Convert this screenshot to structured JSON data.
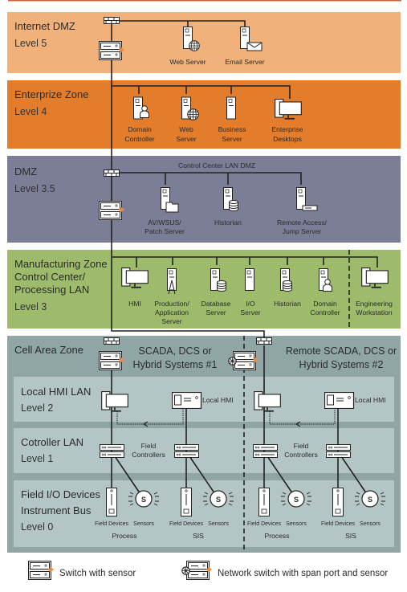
{
  "colors": {
    "internet_dmz": "#f0b27a",
    "enterprise": "#e37d2b",
    "dmz": "#7b7e96",
    "manufacturing": "#9dbb6b",
    "cell_area": "#8fa6a5",
    "cell_subzone": "#b3c5c4",
    "sensor_accent": "#f08a3c"
  },
  "zones": {
    "internet_dmz": {
      "title": "Internet DMZ",
      "level": "Level 5",
      "devices": [
        {
          "label": [
            "Web Server"
          ],
          "icon": "server-globe-icon"
        },
        {
          "label": [
            "Email Server"
          ],
          "icon": "server-email-icon"
        }
      ]
    },
    "enterprise": {
      "title": "Enterprize Zone",
      "level": "Level 4",
      "devices": [
        {
          "label": [
            "Domain",
            "Controller"
          ],
          "icon": "server-user-icon"
        },
        {
          "label": [
            "Web",
            "Server"
          ],
          "icon": "server-globe-icon"
        },
        {
          "label": [
            "Business",
            "Server"
          ],
          "icon": "server-icon"
        },
        {
          "label": [
            "Enterprise",
            "Desktops"
          ],
          "icon": "desktop-icon"
        }
      ]
    },
    "dmz": {
      "title": "DMZ",
      "level": "Level 3.5",
      "network": "Control Center LAN DMZ",
      "devices": [
        {
          "label": [
            "AV/WSUS/",
            "Patch Server"
          ],
          "icon": "server-folder-icon"
        },
        {
          "label": [
            "Historian"
          ],
          "icon": "server-database-icon"
        },
        {
          "label": [
            "Remote Access/",
            "Jump Server"
          ],
          "icon": "server-remote-icon"
        }
      ]
    },
    "manufacturing": {
      "title": [
        "Manufacturing Zone",
        "Control Center/",
        "Processing LAN"
      ],
      "level": "Level 3",
      "devices": [
        {
          "label": [
            "HMI"
          ]
        },
        {
          "label": [
            "Production/",
            "Application",
            "Server"
          ]
        },
        {
          "label": [
            "Database",
            "Server"
          ]
        },
        {
          "label": [
            "I/O",
            "Server"
          ]
        },
        {
          "label": [
            "Historian"
          ]
        },
        {
          "label": [
            "Domain",
            "Controller"
          ]
        },
        {
          "label": [
            "Engineering",
            "Workstation"
          ]
        }
      ]
    },
    "cell_area": {
      "title": "Cell Area Zone",
      "system1": [
        "SCADA, DCS or",
        "Hybrid Systems #1"
      ],
      "system2": [
        "Remote SCADA, DCS or",
        "Hybrid Systems #2"
      ],
      "local_hmi_lan": {
        "title": "Local HMI LAN",
        "level": "Level 2",
        "local_hmi": "Local HMI"
      },
      "controller_lan": {
        "title": "Cotroller LAN",
        "level": "Level 1",
        "field_controllers": [
          "Field",
          "Controllers"
        ]
      },
      "field_io": {
        "title": [
          "Field I/O Devices",
          "Instrument Bus"
        ],
        "level": "Level 0",
        "field_devices": "Field Devices",
        "sensors": "Sensors",
        "sensor_symbol": "S",
        "groups": [
          "Process",
          "SIS",
          "Process",
          "SIS"
        ]
      }
    }
  },
  "legend": {
    "switch_sensor": "Switch with sensor",
    "network_switch": "Network switch with span port and sensor"
  }
}
